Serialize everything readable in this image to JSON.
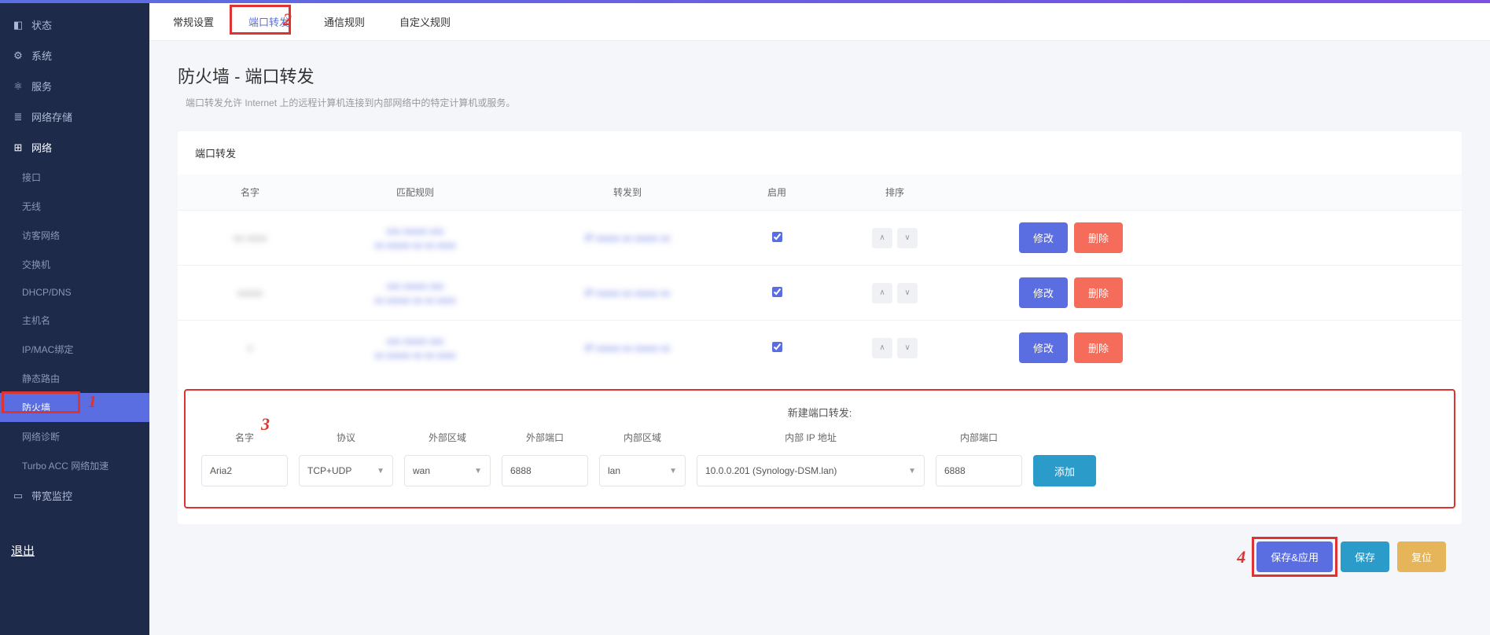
{
  "sidebar": {
    "items": [
      {
        "label": "状态",
        "icon": "◧"
      },
      {
        "label": "系统",
        "icon": "⚙"
      },
      {
        "label": "服务",
        "icon": "⚛"
      },
      {
        "label": "网络存储",
        "icon": "≣"
      },
      {
        "label": "网络",
        "icon": "⊞"
      },
      {
        "label": "带宽监控",
        "icon": "▭"
      }
    ],
    "network_sub": [
      "接口",
      "无线",
      "访客网络",
      "交换机",
      "DHCP/DNS",
      "主机名",
      "IP/MAC绑定",
      "静态路由",
      "防火墙",
      "网络诊断",
      "Turbo ACC 网络加速"
    ],
    "logout": "退出"
  },
  "tabs": [
    "常规设置",
    "端口转发",
    "通信规则",
    "自定义规则"
  ],
  "page": {
    "title": "防火墙 - 端口转发",
    "desc": "端口转发允许 Internet 上的远程计算机连接到内部网络中的特定计算机或服务。"
  },
  "table": {
    "section_title": "端口转发",
    "headers": [
      "名字",
      "匹配规则",
      "转发到",
      "启用",
      "排序",
      ""
    ],
    "rows": [
      {
        "name": "blurred",
        "match": "blurred rule text line\nand second line",
        "forward": "IP forward blurred",
        "enabled": true
      },
      {
        "name": "blurred",
        "match": "blurred rule text line\nand second line",
        "forward": "IP forward blurred",
        "enabled": true
      },
      {
        "name": "blurred",
        "match": "blurred rule text line\nand second line",
        "forward": "IP forward blurred",
        "enabled": true
      }
    ],
    "actions": {
      "edit": "修改",
      "delete": "删除"
    }
  },
  "new_forward": {
    "title": "新建端口转发:",
    "labels": [
      "名字",
      "协议",
      "外部区域",
      "外部端口",
      "内部区域",
      "内部 IP 地址",
      "内部端口",
      ""
    ],
    "fields": {
      "name": "Aria2",
      "protocol": "TCP+UDP",
      "ext_zone": "wan",
      "ext_port": "6888",
      "int_zone": "lan",
      "int_ip": "10.0.0.201 (Synology-DSM.lan)",
      "int_port": "6888",
      "add": "添加"
    }
  },
  "footer": {
    "save_apply": "保存&应用",
    "save": "保存",
    "reset": "复位"
  },
  "annotations": {
    "a1": "1",
    "a2": "2",
    "a3": "3",
    "a4": "4"
  }
}
